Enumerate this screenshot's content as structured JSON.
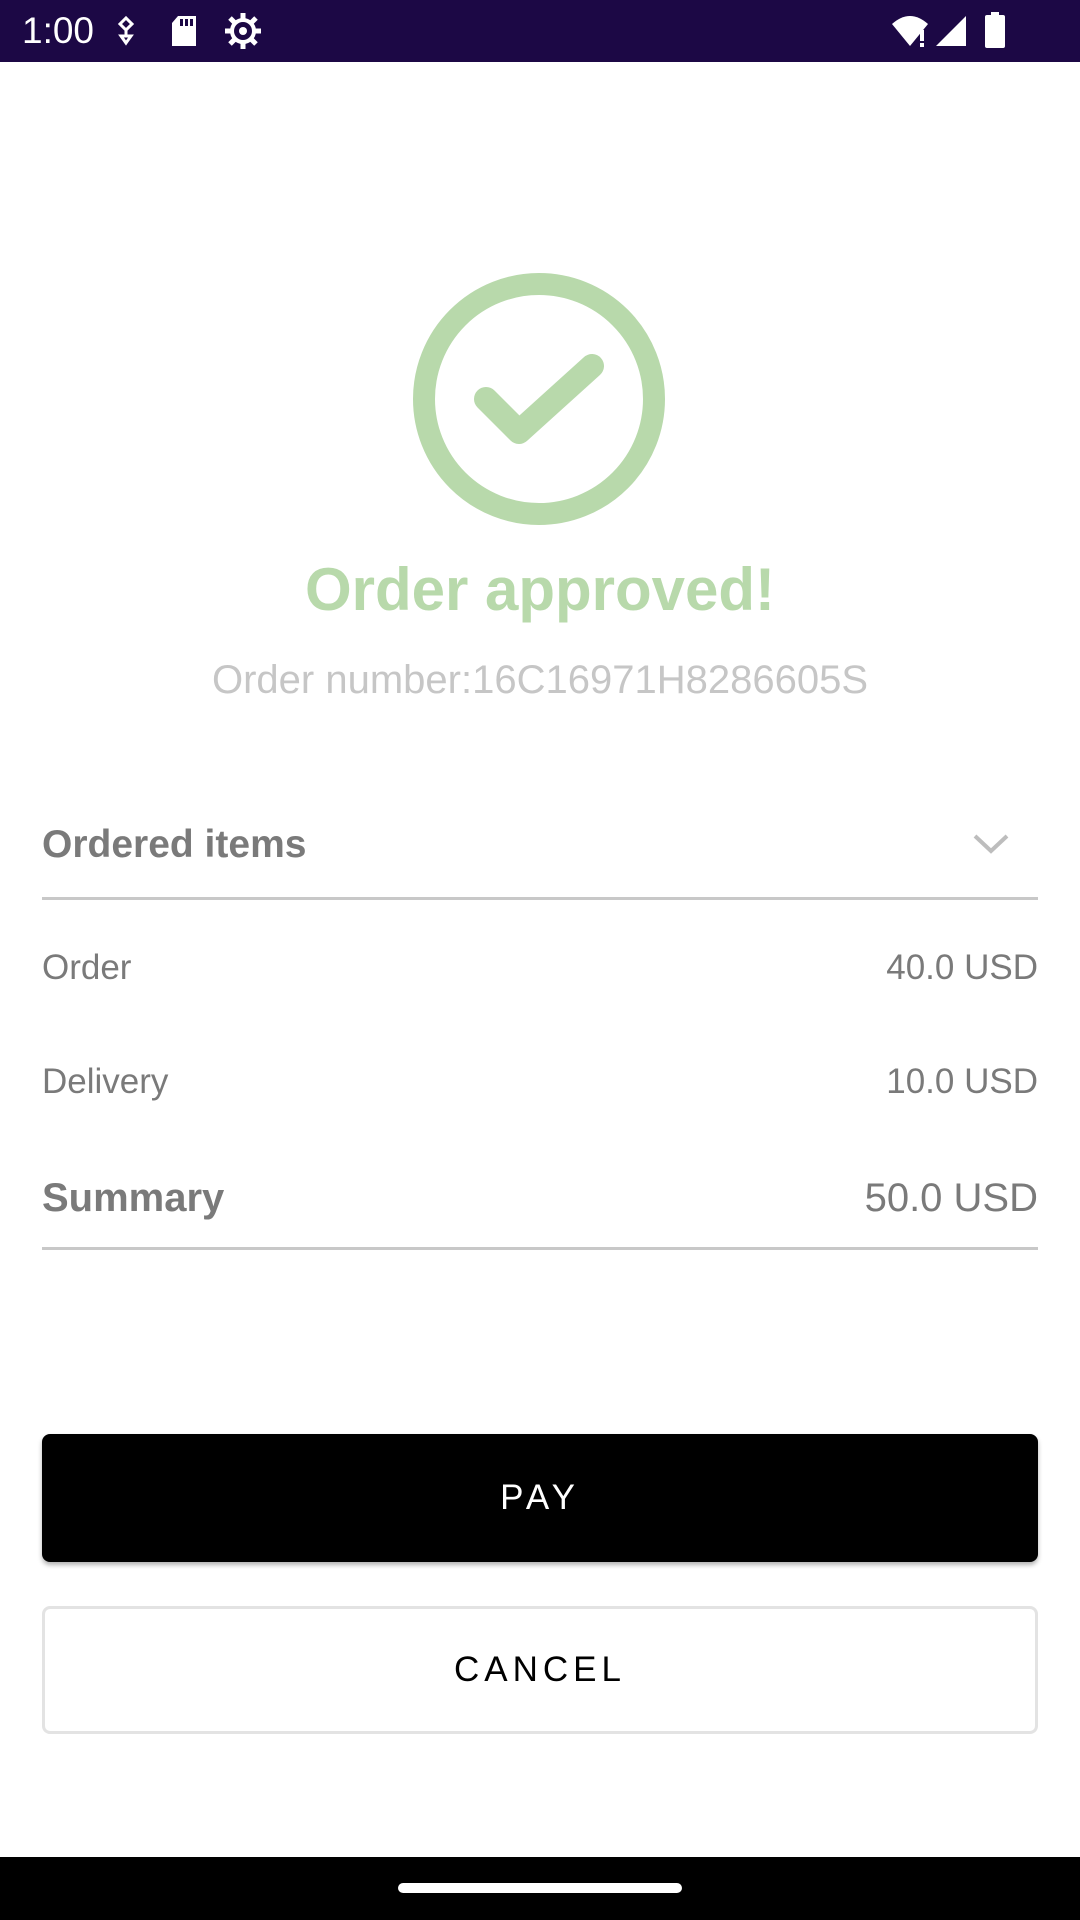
{
  "status_bar": {
    "time": "1:00",
    "icons_left": [
      "key-icon",
      "sd-card-icon",
      "settings-icon"
    ],
    "icons_right": [
      "wifi-icon",
      "signal-icon",
      "battery-icon"
    ]
  },
  "order": {
    "status_icon": "check-circle-icon",
    "title": "Order approved!",
    "number_text": "Order number:16C16971H8286605S"
  },
  "ordered_items": {
    "label": "Ordered items",
    "toggle_icon": "chevron-down-icon"
  },
  "costs": [
    {
      "label": "Order",
      "value": "40.0 USD"
    },
    {
      "label": "Delivery",
      "value": "10.0 USD"
    }
  ],
  "summary": {
    "label": "Summary",
    "value": "50.0 USD"
  },
  "buttons": {
    "pay": "PAY",
    "cancel": "CANCEL"
  },
  "colors": {
    "status_bar": "#1c0845",
    "success_green": "#b8d9ab",
    "primary_button": "#000000"
  }
}
